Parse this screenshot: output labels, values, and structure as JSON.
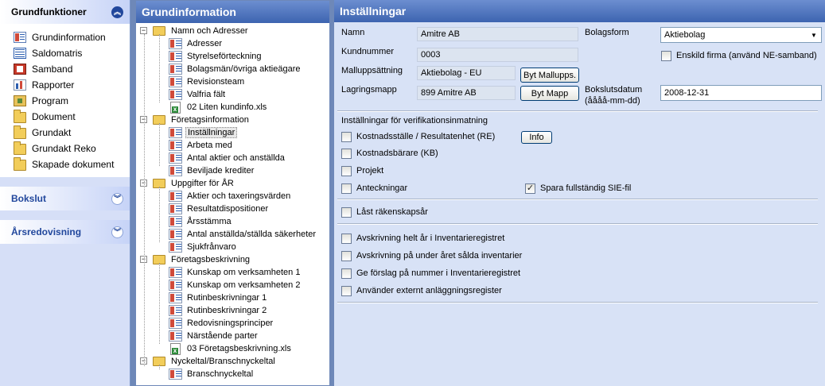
{
  "nav": {
    "header_title": "Grundfunktioner",
    "items": [
      {
        "label": "Grundinformation",
        "icon": "grid-doc-icon"
      },
      {
        "label": "Saldomatris",
        "icon": "matrix-icon"
      },
      {
        "label": "Samband",
        "icon": "book-icon"
      },
      {
        "label": "Rapporter",
        "icon": "report-icon"
      },
      {
        "label": "Program",
        "icon": "program-icon"
      },
      {
        "label": "Dokument",
        "icon": "folder-icon"
      },
      {
        "label": "Grundakt",
        "icon": "folder-icon"
      },
      {
        "label": "Grundakt Reko",
        "icon": "folder-icon"
      },
      {
        "label": "Skapade dokument",
        "icon": "folder-icon"
      }
    ],
    "section2_title": "Bokslut",
    "section3_title": "Årsredovisning"
  },
  "tree": {
    "title": "Grundinformation",
    "groups": [
      {
        "label": "Namn och Adresser",
        "children": [
          "Adresser",
          "Styrelseförteckning",
          "Bolagsmän/övriga aktieägare",
          "Revisionsteam",
          "Valfria fält",
          "02 Liten kundinfo.xls"
        ]
      },
      {
        "label": "Företagsinformation",
        "children": [
          "Inställningar",
          "Arbeta med",
          "Antal aktier och anställda",
          "Beviljade krediter"
        ]
      },
      {
        "label": "Uppgifter för ÅR",
        "children": [
          "Aktier och taxeringsvärden",
          "Resultatdispositioner",
          "Årsstämma",
          "Antal anställda/ställda säkerheter",
          "Sjukfrånvaro"
        ]
      },
      {
        "label": "Företagsbeskrivning",
        "children": [
          "Kunskap om verksamheten 1",
          "Kunskap om verksamheten 2",
          "Rutinbeskrivningar 1",
          "Rutinbeskrivningar 2",
          "Redovisningsprinciper",
          "Närstående parter",
          "03 Företagsbeskrivning.xls"
        ]
      },
      {
        "label": "Nyckeltal/Branschnyckeltal",
        "children": [
          "Branschnyckeltal"
        ]
      }
    ]
  },
  "settings": {
    "title": "Inställningar",
    "namn_label": "Namn",
    "namn_value": "Amitre AB",
    "kundnummer_label": "Kundnummer",
    "kundnummer_value": "0003",
    "malluppsattning_label": "Malluppsättning",
    "malluppsattning_value": "Aktiebolag - EU",
    "byt_mallupps_button": "Byt Mallupps.",
    "lagringsmapp_label": "Lagringsmapp",
    "lagringsmapp_value": "899 Amitre AB",
    "byt_mapp_button": "Byt Mapp",
    "bolagsform_label": "Bolagsform",
    "bolagsform_value": "Aktiebolag",
    "enskild_firma_label": "Enskild firma (använd NE-samband)",
    "bokslutsdatum_label": "Bokslutsdatum",
    "bokslutsdatum_format": "(åååå-mm-dd)",
    "bokslutsdatum_value": "2008-12-31",
    "verifikation_heading": "Inställningar för verifikationsinmatning",
    "kostnadsstalle_label": "Kostnadsställe / Resultatenhet (RE)",
    "info_button": "Info",
    "kostnadsbarare_label": "Kostnadsbärare (KB)",
    "projekt_label": "Projekt",
    "anteckningar_label": "Anteckningar",
    "spara_sie_label": "Spara fullständig SIE-fil",
    "last_rakenskapsar_label": "Låst räkenskapsår",
    "avskrivning_helt_label": "Avskrivning helt år i Inventarieregistret",
    "avskrivning_under_label": "Avskrivning på under året sålda inventarier",
    "ge_forslag_label": "Ge förslag på nummer i Inventarieregistret",
    "anvander_externt_label": "Använder externt anläggningsregister",
    "check_mark": "✓"
  }
}
